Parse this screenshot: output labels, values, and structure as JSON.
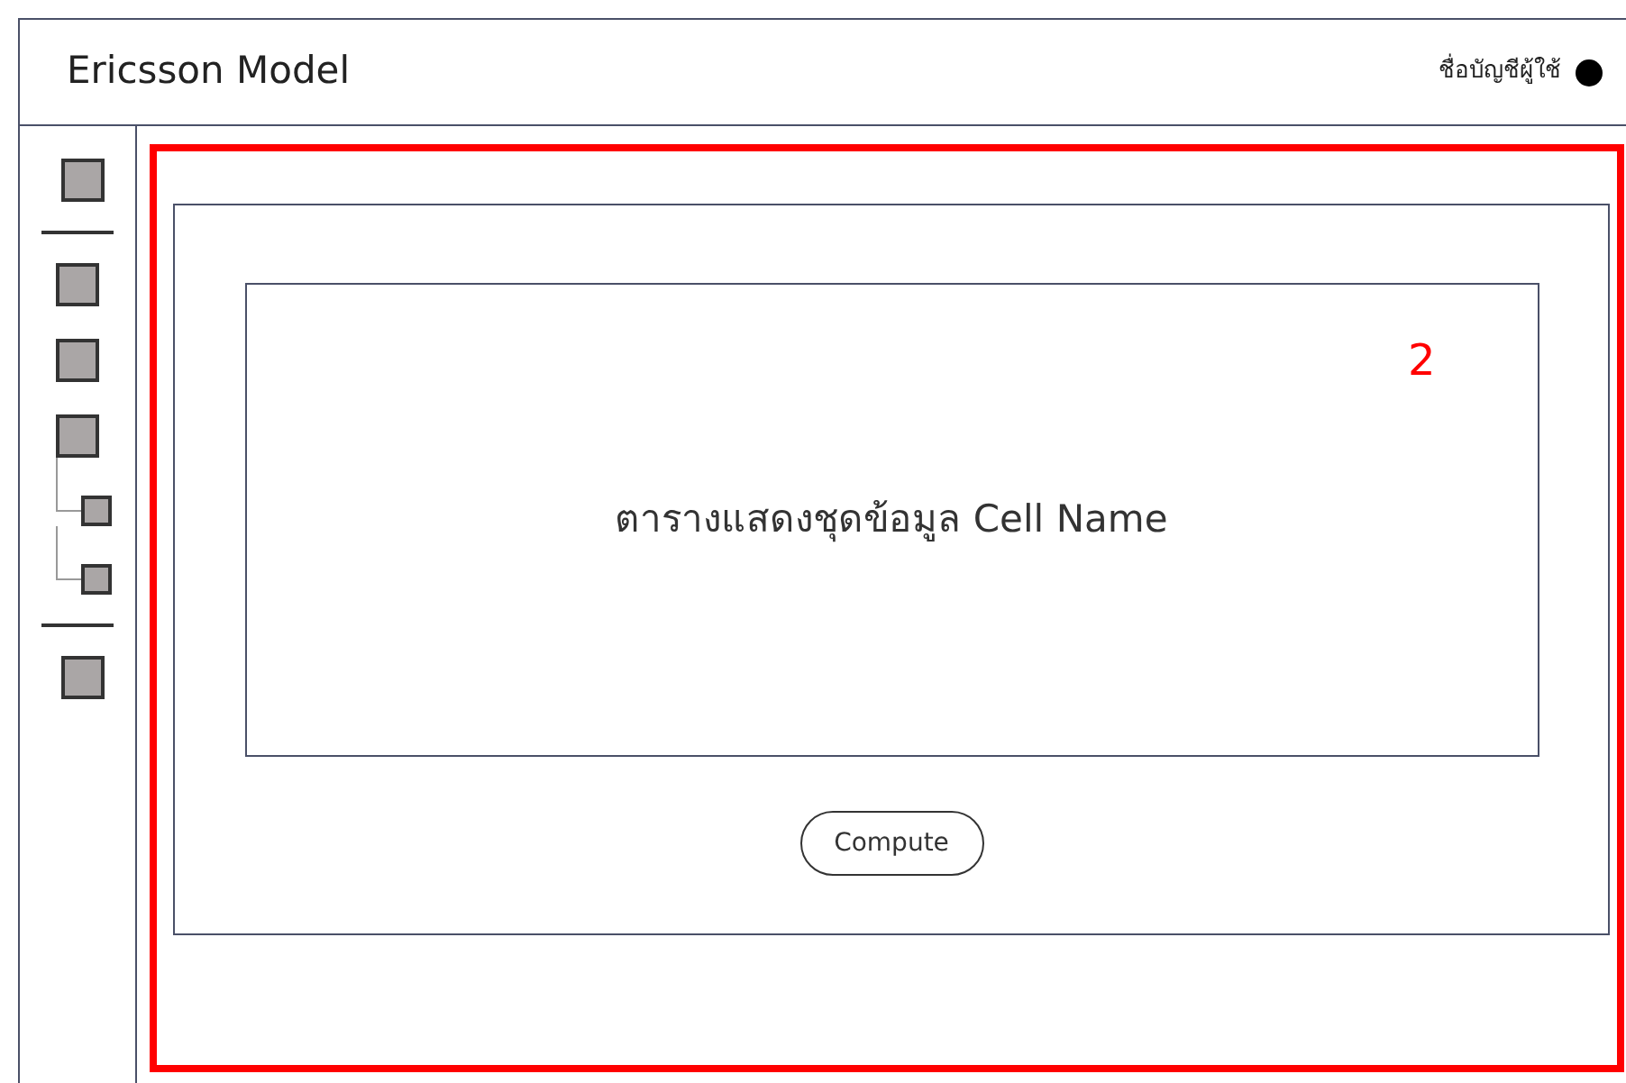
{
  "header": {
    "title": "Ericsson Model",
    "account": "ชื่อบัญชีผู้ใช้"
  },
  "sidebar": {
    "sections": [
      {
        "items": [
          {
            "kind": "square"
          }
        ]
      },
      {
        "items": [
          {
            "kind": "square"
          },
          {
            "kind": "square"
          },
          {
            "kind": "square",
            "children": [
              {
                "kind": "square"
              },
              {
                "kind": "square"
              }
            ]
          }
        ]
      },
      {
        "items": [
          {
            "kind": "square"
          }
        ]
      }
    ]
  },
  "annotation": {
    "label": "2"
  },
  "panel": {
    "table_placeholder": "ตารางแสดงชุดข้อมูล Cell Name",
    "button": "Compute"
  }
}
